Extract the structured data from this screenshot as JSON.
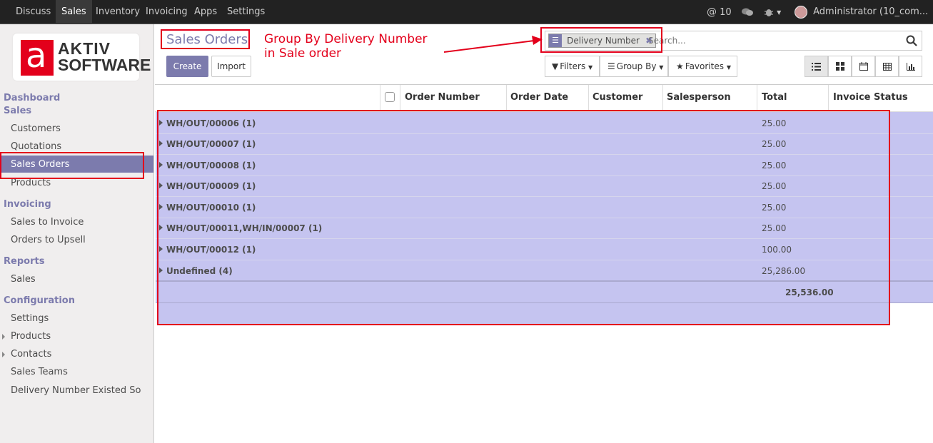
{
  "topbar": {
    "menu": [
      "Discuss",
      "Sales",
      "Inventory",
      "Invoicing",
      "Apps",
      "Settings"
    ],
    "active": "Sales",
    "mentions": "10",
    "user": "Administrator (10_com..."
  },
  "sidebar": {
    "logo_top": "AKTIV",
    "logo_bottom": "SOFTWARE",
    "logo_letter": "a",
    "dashboard": "Dashboard",
    "sales_head": "Sales",
    "sales_items": [
      "Customers",
      "Quotations",
      "Sales Orders",
      "Products"
    ],
    "invoicing_head": "Invoicing",
    "invoicing_items": [
      "Sales to Invoice",
      "Orders to Upsell"
    ],
    "reports_head": "Reports",
    "reports_items": [
      "Sales"
    ],
    "configuration_head": "Configuration",
    "configuration_items": [
      "Settings",
      "Products",
      "Contacts",
      "Sales Teams",
      "Delivery Number Existed So"
    ]
  },
  "control": {
    "title": "Sales Orders",
    "create_label": "Create",
    "import_label": "Import",
    "facet_label": "Delivery Number",
    "search_placeholder": "Search...",
    "filters_label": "Filters",
    "groupby_label": "Group By",
    "favorites_label": "Favorites"
  },
  "annotation": {
    "line1": "Group By Delivery Number",
    "line2": "in Sale order"
  },
  "table": {
    "headers": [
      "Order Number",
      "Order Date",
      "Customer",
      "Salesperson",
      "Total",
      "Invoice Status"
    ],
    "groups": [
      {
        "label": "WH/OUT/00006 (1)",
        "total": "25.00"
      },
      {
        "label": "WH/OUT/00007 (1)",
        "total": "25.00"
      },
      {
        "label": "WH/OUT/00008 (1)",
        "total": "25.00"
      },
      {
        "label": "WH/OUT/00009 (1)",
        "total": "25.00"
      },
      {
        "label": "WH/OUT/00010 (1)",
        "total": "25.00"
      },
      {
        "label": "WH/OUT/00011,WH/IN/00007 (1)",
        "total": "25.00"
      },
      {
        "label": "WH/OUT/00012 (1)",
        "total": "100.00"
      },
      {
        "label": "Undefined (4)",
        "total": "25,286.00"
      }
    ],
    "grand_total": "25,536.00"
  },
  "colors": {
    "accent": "#7c7bad",
    "topbar": "#222222",
    "highlight": "#c5c4f0",
    "annotation_red": "#e3001b"
  }
}
